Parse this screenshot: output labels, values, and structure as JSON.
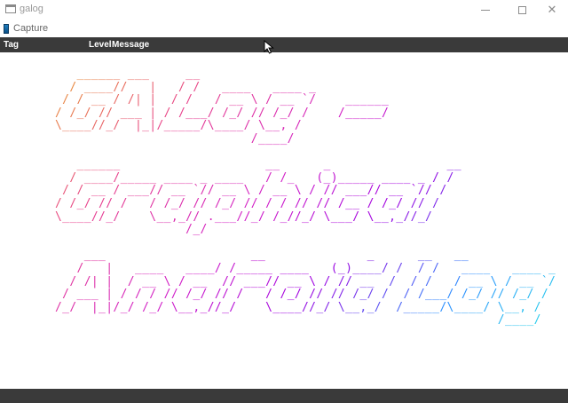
{
  "window": {
    "title": "galog",
    "controls": {
      "minimize": "—",
      "maximize": "",
      "close": "✕"
    }
  },
  "menu": {
    "capture_label": "Capture"
  },
  "table": {
    "columns": {
      "tag": "Tag",
      "level": "Level",
      "message": "Message"
    }
  },
  "banner": {
    "lines": [
      "   ______ ___     __",
      "  / ____//   |   / /   ____   ____ _",
      " / / __ / /| |  / /   / __ \\ / __ `/    ______",
      "/ /_/ // ___ | / /___/ /_/ // /_/ /    /_____/",
      "\\____//_/  |_|/_____/\\____/ \\__, /",
      "                           /____/",
      "",
      "   ______                    __      _                __",
      "  / ____/_____ ____ _ ____   / /_   (_)_____ ____ _ / /",
      " / / __ / ___// __ `// __ \\ / __ \\ / // ___// __ `// /",
      "/ /_/ // /   / /_/ // /_/ // / / // // /__ / /_/ // /",
      "\\____//_/    \\__,_// .___//_/ /_//_/ \\___/ \\__,_//_/",
      "                  /_/",
      "",
      "    ___                    __              _      __   __",
      "   /   |   ____   ____/ /_____ ____   (_)____/ /  / /   ____   ____ _",
      "  / /| |  / __ \\ / __  // ___// __ \\ / // __  /  / /   / __ \\ / __ `/",
      " / ___ | / / / // /_/ // /   / /_/ // // /_/ /  / /___/ /_/ // /_/ /",
      "/_/  |_|/_/ /_/ \\__,_//_/    \\____//_/ \\__,_/  /_____/\\____/ \\__, /",
      "                                                             /____/"
    ]
  },
  "colors": {
    "header_bg": "#3a3a3a",
    "gradient": [
      "#e89a2c",
      "#e8408a",
      "#d01cc8",
      "#a000e0",
      "#2a8cff",
      "#26d9e8"
    ]
  },
  "icons": [
    "app-window-icon",
    "capture-device-icon",
    "minimize-icon",
    "maximize-icon",
    "close-icon",
    "mouse-cursor-icon"
  ]
}
